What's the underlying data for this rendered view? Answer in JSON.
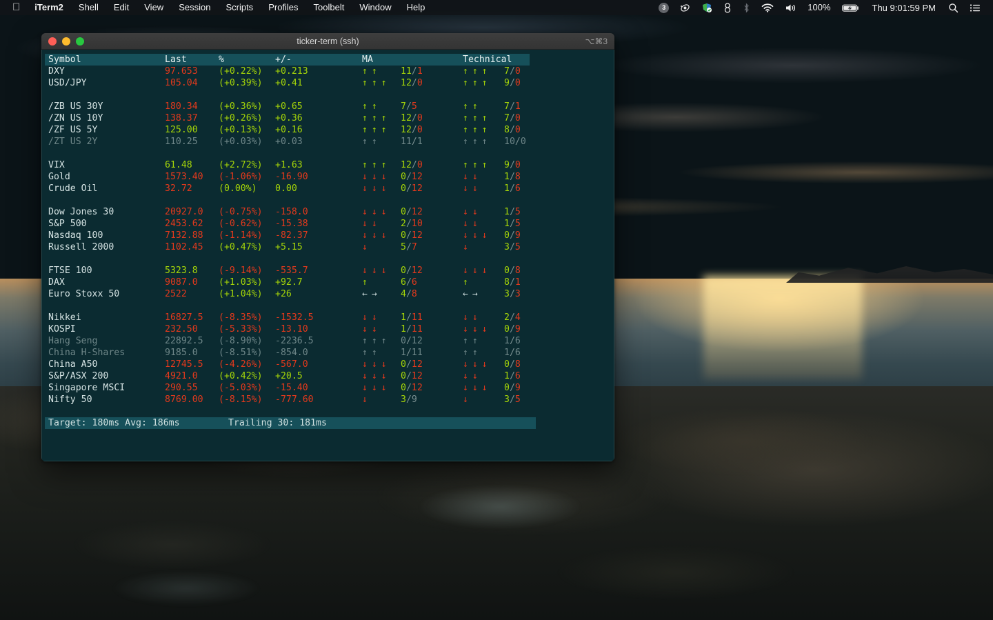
{
  "menubar": {
    "apple_logo": "apple-logo",
    "items": [
      "iTerm2",
      "Shell",
      "Edit",
      "View",
      "Session",
      "Scripts",
      "Profiles",
      "Toolbelt",
      "Window",
      "Help"
    ],
    "status": {
      "notification_badge": "3",
      "battery_percent": "100%",
      "clock": "Thu 9:01:59 PM",
      "icons": [
        "orbit-icon",
        "app-badge-icon",
        "keybase-icon",
        "bluetooth-icon",
        "wifi-icon",
        "volume-icon",
        "battery-charging-icon",
        "search-icon",
        "control-center-icon"
      ]
    }
  },
  "window": {
    "title": "ticker-term (ssh)",
    "shortcut": "⌥⌘3",
    "traffic_lights": [
      "close-button",
      "minimize-button",
      "zoom-button"
    ]
  },
  "terminal": {
    "headers": [
      "Symbol",
      "Last",
      "%",
      "+/-",
      "MA",
      "Technical"
    ],
    "status": {
      "target": "Target: 180ms  Avg: 186ms",
      "trailing": "Trailing 30: 181ms"
    },
    "groups": [
      {
        "rows": [
          {
            "symbol": "DXY",
            "symbol_tone": "white",
            "last": "97.653",
            "last_tone": "red",
            "pct": "(+0.22%)",
            "pct_tone": "green",
            "chg": "+0.213",
            "chg_tone": "green",
            "ma_arrows": [
              "up",
              "up"
            ],
            "ma_num": "11",
            "ma_den": "1",
            "ma_num_tone": "green",
            "ma_den_tone": "red",
            "tech_arrows": [
              "up",
              "up",
              "up"
            ],
            "tech_num": "7",
            "tech_den": "0",
            "tech_num_tone": "green",
            "tech_den_tone": "red"
          },
          {
            "symbol": "USD/JPY",
            "symbol_tone": "white",
            "last": "105.04",
            "last_tone": "red",
            "pct": "(+0.39%)",
            "pct_tone": "green",
            "chg": "+0.41",
            "chg_tone": "green",
            "ma_arrows": [
              "up",
              "up",
              "up"
            ],
            "ma_num": "12",
            "ma_den": "0",
            "ma_num_tone": "green",
            "ma_den_tone": "red",
            "tech_arrows": [
              "up",
              "up",
              "up"
            ],
            "tech_num": "9",
            "tech_den": "0",
            "tech_num_tone": "green",
            "tech_den_tone": "red"
          }
        ]
      },
      {
        "rows": [
          {
            "symbol": "/ZB US 30Y",
            "symbol_tone": "white",
            "last": "180.34",
            "last_tone": "red",
            "pct": "(+0.36%)",
            "pct_tone": "green",
            "chg": "+0.65",
            "chg_tone": "green",
            "ma_arrows": [
              "up",
              "up"
            ],
            "ma_num": "7",
            "ma_den": "5",
            "ma_num_tone": "green",
            "ma_den_tone": "red",
            "tech_arrows": [
              "up",
              "up"
            ],
            "tech_num": "7",
            "tech_den": "1",
            "tech_num_tone": "green",
            "tech_den_tone": "red"
          },
          {
            "symbol": "/ZN US 10Y",
            "symbol_tone": "white",
            "last": "138.37",
            "last_tone": "red",
            "pct": "(+0.26%)",
            "pct_tone": "green",
            "chg": "+0.36",
            "chg_tone": "green",
            "ma_arrows": [
              "up",
              "up",
              "up"
            ],
            "ma_num": "12",
            "ma_den": "0",
            "ma_num_tone": "green",
            "ma_den_tone": "red",
            "tech_arrows": [
              "up",
              "up",
              "up"
            ],
            "tech_num": "7",
            "tech_den": "0",
            "tech_num_tone": "green",
            "tech_den_tone": "red"
          },
          {
            "symbol": "/ZF US 5Y",
            "symbol_tone": "white",
            "last": "125.00",
            "last_tone": "green",
            "pct": "(+0.13%)",
            "pct_tone": "green",
            "chg": "+0.16",
            "chg_tone": "green",
            "ma_arrows": [
              "up",
              "up",
              "up"
            ],
            "ma_num": "12",
            "ma_den": "0",
            "ma_num_tone": "green",
            "ma_den_tone": "red",
            "tech_arrows": [
              "up",
              "up",
              "up"
            ],
            "tech_num": "8",
            "tech_den": "0",
            "tech_num_tone": "green",
            "tech_den_tone": "red"
          },
          {
            "symbol": "/ZT US 2Y",
            "symbol_tone": "dim",
            "last": "110.25",
            "last_tone": "dim",
            "pct": "(+0.03%)",
            "pct_tone": "dim",
            "chg": "+0.03",
            "chg_tone": "dim",
            "ma_arrows": [
              "dimg",
              "dimg"
            ],
            "ma_num": "11",
            "ma_den": "1",
            "ma_num_tone": "dim",
            "ma_den_tone": "dim",
            "tech_arrows": [
              "dimg",
              "dimg",
              "dimg"
            ],
            "tech_num": "10",
            "tech_den": "0",
            "tech_num_tone": "dim",
            "tech_den_tone": "dim"
          }
        ]
      },
      {
        "rows": [
          {
            "symbol": "VIX",
            "symbol_tone": "white",
            "last": "61.48",
            "last_tone": "green",
            "pct": "(+2.72%)",
            "pct_tone": "green",
            "chg": "+1.63",
            "chg_tone": "green",
            "ma_arrows": [
              "up",
              "up",
              "up"
            ],
            "ma_num": "12",
            "ma_den": "0",
            "ma_num_tone": "green",
            "ma_den_tone": "red",
            "tech_arrows": [
              "up",
              "up",
              "up"
            ],
            "tech_num": "9",
            "tech_den": "0",
            "tech_num_tone": "green",
            "tech_den_tone": "red"
          },
          {
            "symbol": "Gold",
            "symbol_tone": "white",
            "last": "1573.40",
            "last_tone": "red",
            "pct": "(-1.06%)",
            "pct_tone": "red",
            "chg": "-16.90",
            "chg_tone": "red",
            "ma_arrows": [
              "down",
              "down",
              "down"
            ],
            "ma_num": "0",
            "ma_den": "12",
            "ma_num_tone": "green",
            "ma_den_tone": "red",
            "tech_arrows": [
              "down",
              "down"
            ],
            "tech_num": "1",
            "tech_den": "8",
            "tech_num_tone": "green",
            "tech_den_tone": "red"
          },
          {
            "symbol": "Crude Oil",
            "symbol_tone": "white",
            "last": "32.72",
            "last_tone": "red",
            "pct": "(0.00%)",
            "pct_tone": "green",
            "chg": "0.00",
            "chg_tone": "green",
            "ma_arrows": [
              "down",
              "down",
              "down"
            ],
            "ma_num": "0",
            "ma_den": "12",
            "ma_num_tone": "green",
            "ma_den_tone": "red",
            "tech_arrows": [
              "down",
              "down"
            ],
            "tech_num": "1",
            "tech_den": "6",
            "tech_num_tone": "green",
            "tech_den_tone": "red"
          }
        ]
      },
      {
        "rows": [
          {
            "symbol": "Dow Jones 30",
            "symbol_tone": "white",
            "last": "20927.0",
            "last_tone": "red",
            "pct": "(-0.75%)",
            "pct_tone": "red",
            "chg": "-158.0",
            "chg_tone": "red",
            "ma_arrows": [
              "down",
              "down",
              "down"
            ],
            "ma_num": "0",
            "ma_den": "12",
            "ma_num_tone": "green",
            "ma_den_tone": "red",
            "tech_arrows": [
              "down",
              "down"
            ],
            "tech_num": "1",
            "tech_den": "5",
            "tech_num_tone": "green",
            "tech_den_tone": "red"
          },
          {
            "symbol": "S&P 500",
            "symbol_tone": "white",
            "last": "2453.62",
            "last_tone": "red",
            "pct": "(-0.62%)",
            "pct_tone": "red",
            "chg": "-15.38",
            "chg_tone": "red",
            "ma_arrows": [
              "down",
              "down"
            ],
            "ma_num": "2",
            "ma_den": "10",
            "ma_num_tone": "green",
            "ma_den_tone": "red",
            "tech_arrows": [
              "down",
              "down"
            ],
            "tech_num": "1",
            "tech_den": "5",
            "tech_num_tone": "green",
            "tech_den_tone": "red"
          },
          {
            "symbol": "Nasdaq 100",
            "symbol_tone": "white",
            "last": "7132.88",
            "last_tone": "red",
            "pct": "(-1.14%)",
            "pct_tone": "red",
            "chg": "-82.37",
            "chg_tone": "red",
            "ma_arrows": [
              "down",
              "down",
              "down"
            ],
            "ma_num": "0",
            "ma_den": "12",
            "ma_num_tone": "green",
            "ma_den_tone": "red",
            "tech_arrows": [
              "down",
              "down",
              "down"
            ],
            "tech_num": "0",
            "tech_den": "9",
            "tech_num_tone": "green",
            "tech_den_tone": "red"
          },
          {
            "symbol": "Russell 2000",
            "symbol_tone": "white",
            "last": "1102.45",
            "last_tone": "red",
            "pct": "(+0.47%)",
            "pct_tone": "green",
            "chg": "+5.15",
            "chg_tone": "green",
            "ma_arrows": [
              "down"
            ],
            "ma_num": "5",
            "ma_den": "7",
            "ma_num_tone": "green",
            "ma_den_tone": "red",
            "tech_arrows": [
              "down"
            ],
            "tech_num": "3",
            "tech_den": "5",
            "tech_num_tone": "green",
            "tech_den_tone": "red"
          }
        ]
      },
      {
        "rows": [
          {
            "symbol": "FTSE 100",
            "symbol_tone": "white",
            "last": "5323.8",
            "last_tone": "green",
            "pct": "(-9.14%)",
            "pct_tone": "red",
            "chg": "-535.7",
            "chg_tone": "red",
            "ma_arrows": [
              "down",
              "down",
              "down"
            ],
            "ma_num": "0",
            "ma_den": "12",
            "ma_num_tone": "green",
            "ma_den_tone": "red",
            "tech_arrows": [
              "down",
              "down",
              "down"
            ],
            "tech_num": "0",
            "tech_den": "8",
            "tech_num_tone": "green",
            "tech_den_tone": "red"
          },
          {
            "symbol": "DAX",
            "symbol_tone": "white",
            "last": "9087.0",
            "last_tone": "red",
            "pct": "(+1.03%)",
            "pct_tone": "green",
            "chg": "+92.7",
            "chg_tone": "green",
            "ma_arrows": [
              "up"
            ],
            "ma_num": "6",
            "ma_den": "6",
            "ma_num_tone": "green",
            "ma_den_tone": "red",
            "tech_arrows": [
              "up"
            ],
            "tech_num": "8",
            "tech_den": "1",
            "tech_num_tone": "green",
            "tech_den_tone": "red"
          },
          {
            "symbol": "Euro Stoxx 50",
            "symbol_tone": "white",
            "last": "2522",
            "last_tone": "red",
            "pct": "(+1.04%)",
            "pct_tone": "green",
            "chg": "+26",
            "chg_tone": "green",
            "ma_arrows": [
              "left",
              "right"
            ],
            "ma_num": "4",
            "ma_den": "8",
            "ma_num_tone": "green",
            "ma_den_tone": "red",
            "tech_arrows": [
              "left",
              "right"
            ],
            "tech_num": "3",
            "tech_den": "3",
            "tech_num_tone": "green",
            "tech_den_tone": "red"
          }
        ]
      },
      {
        "rows": [
          {
            "symbol": "Nikkei",
            "symbol_tone": "white",
            "last": "16827.5",
            "last_tone": "red",
            "pct": "(-8.35%)",
            "pct_tone": "red",
            "chg": "-1532.5",
            "chg_tone": "red",
            "ma_arrows": [
              "down",
              "down"
            ],
            "ma_num": "1",
            "ma_den": "11",
            "ma_num_tone": "green",
            "ma_den_tone": "red",
            "tech_arrows": [
              "down",
              "down"
            ],
            "tech_num": "2",
            "tech_den": "4",
            "tech_num_tone": "green",
            "tech_den_tone": "red"
          },
          {
            "symbol": "KOSPI",
            "symbol_tone": "white",
            "last": "232.50",
            "last_tone": "red",
            "pct": "(-5.33%)",
            "pct_tone": "red",
            "chg": "-13.10",
            "chg_tone": "red",
            "ma_arrows": [
              "down",
              "down"
            ],
            "ma_num": "1",
            "ma_den": "11",
            "ma_num_tone": "green",
            "ma_den_tone": "red",
            "tech_arrows": [
              "down",
              "down",
              "down"
            ],
            "tech_num": "0",
            "tech_den": "9",
            "tech_num_tone": "green",
            "tech_den_tone": "red"
          },
          {
            "symbol": "Hang Seng",
            "symbol_tone": "dim",
            "last": "22892.5",
            "last_tone": "dim",
            "pct": "(-8.90%)",
            "pct_tone": "dim",
            "chg": "-2236.5",
            "chg_tone": "dim",
            "ma_arrows": [
              "dimg",
              "dimg",
              "dimg"
            ],
            "ma_num": "0",
            "ma_den": "12",
            "ma_num_tone": "dim",
            "ma_den_tone": "dim",
            "tech_arrows": [
              "dimg",
              "dimg"
            ],
            "tech_num": "1",
            "tech_den": "6",
            "tech_num_tone": "dim",
            "tech_den_tone": "dim"
          },
          {
            "symbol": "China H-Shares",
            "symbol_tone": "dim",
            "last": "9185.0",
            "last_tone": "dim",
            "pct": "(-8.51%)",
            "pct_tone": "dim",
            "chg": "-854.0",
            "chg_tone": "dim",
            "ma_arrows": [
              "dimg",
              "dimg"
            ],
            "ma_num": "1",
            "ma_den": "11",
            "ma_num_tone": "dim",
            "ma_den_tone": "dim",
            "tech_arrows": [
              "dimg",
              "dimg"
            ],
            "tech_num": "1",
            "tech_den": "6",
            "tech_num_tone": "dim",
            "tech_den_tone": "dim"
          },
          {
            "symbol": "China A50",
            "symbol_tone": "white",
            "last": "12745.5",
            "last_tone": "red",
            "pct": "(-4.26%)",
            "pct_tone": "red",
            "chg": "-567.0",
            "chg_tone": "red",
            "ma_arrows": [
              "down",
              "down",
              "down"
            ],
            "ma_num": "0",
            "ma_den": "12",
            "ma_num_tone": "green",
            "ma_den_tone": "red",
            "tech_arrows": [
              "down",
              "down",
              "down"
            ],
            "tech_num": "0",
            "tech_den": "8",
            "tech_num_tone": "green",
            "tech_den_tone": "red"
          },
          {
            "symbol": "S&P/ASX 200",
            "symbol_tone": "white",
            "last": "4921.0",
            "last_tone": "red",
            "pct": "(+0.42%)",
            "pct_tone": "green",
            "chg": "+20.5",
            "chg_tone": "green",
            "ma_arrows": [
              "down",
              "down",
              "down"
            ],
            "ma_num": "0",
            "ma_den": "12",
            "ma_num_tone": "green",
            "ma_den_tone": "red",
            "tech_arrows": [
              "down",
              "down"
            ],
            "tech_num": "1",
            "tech_den": "6",
            "tech_num_tone": "green",
            "tech_den_tone": "red"
          },
          {
            "symbol": "Singapore MSCI",
            "symbol_tone": "white",
            "last": "290.55",
            "last_tone": "red",
            "pct": "(-5.03%)",
            "pct_tone": "red",
            "chg": "-15.40",
            "chg_tone": "red",
            "ma_arrows": [
              "down",
              "down",
              "down"
            ],
            "ma_num": "0",
            "ma_den": "12",
            "ma_num_tone": "green",
            "ma_den_tone": "red",
            "tech_arrows": [
              "down",
              "down",
              "down"
            ],
            "tech_num": "0",
            "tech_den": "9",
            "tech_num_tone": "green",
            "tech_den_tone": "red"
          },
          {
            "symbol": "Nifty 50",
            "symbol_tone": "white",
            "last": "8769.00",
            "last_tone": "red",
            "pct": "(-8.15%)",
            "pct_tone": "red",
            "chg": "-777.60",
            "chg_tone": "red",
            "ma_arrows": [
              "down"
            ],
            "ma_num": "3",
            "ma_den": "9",
            "ma_num_tone": "green",
            "ma_den_tone": "slash",
            "tech_arrows": [
              "down"
            ],
            "tech_num": "3",
            "tech_den": "5",
            "tech_num_tone": "green",
            "tech_den_tone": "red"
          }
        ]
      }
    ]
  },
  "colors": {
    "green": "#a6d608",
    "red": "#e5391c",
    "dim": "#6f8789",
    "terminal_bg": "#0b2b31",
    "header_bg": "#16505a"
  }
}
